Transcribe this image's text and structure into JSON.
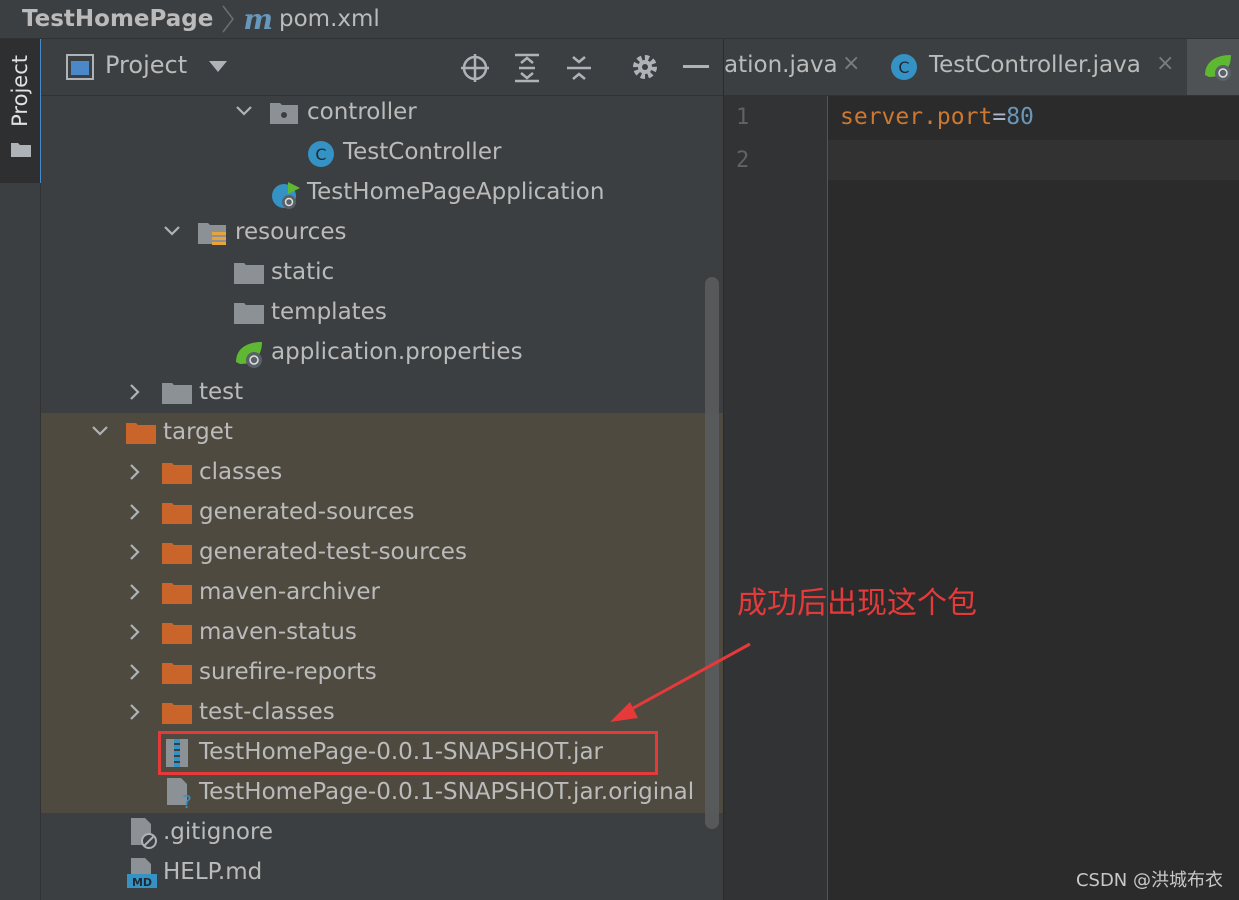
{
  "breadcrumb": {
    "project": "TestHomePage",
    "file_icon_letter": "m",
    "file": "pom.xml"
  },
  "left_strip": {
    "project_tab": "Project"
  },
  "project_panel": {
    "title": "Project",
    "tree": [
      {
        "label": "controller",
        "type": "package",
        "expanded": true
      },
      {
        "label": "TestController",
        "type": "class",
        "icon_letter": "C"
      },
      {
        "label": "TestHomePageApplication",
        "type": "spring-app"
      },
      {
        "label": "resources",
        "type": "resources-folder",
        "expanded": true
      },
      {
        "label": "static",
        "type": "folder"
      },
      {
        "label": "templates",
        "type": "folder"
      },
      {
        "label": "application.properties",
        "type": "spring-properties"
      },
      {
        "label": "test",
        "type": "folder",
        "expanded": false
      },
      {
        "label": "target",
        "type": "excluded-folder",
        "expanded": true
      },
      {
        "label": "classes",
        "type": "excluded-folder",
        "expanded": false
      },
      {
        "label": "generated-sources",
        "type": "excluded-folder",
        "expanded": false
      },
      {
        "label": "generated-test-sources",
        "type": "excluded-folder",
        "expanded": false
      },
      {
        "label": "maven-archiver",
        "type": "excluded-folder",
        "expanded": false
      },
      {
        "label": "maven-status",
        "type": "excluded-folder",
        "expanded": false
      },
      {
        "label": "surefire-reports",
        "type": "excluded-folder",
        "expanded": false
      },
      {
        "label": "test-classes",
        "type": "excluded-folder",
        "expanded": false
      },
      {
        "label": "TestHomePage-0.0.1-SNAPSHOT.jar",
        "type": "jar"
      },
      {
        "label": "TestHomePage-0.0.1-SNAPSHOT.jar.original",
        "type": "unknown-file"
      },
      {
        "label": ".gitignore",
        "type": "ignore-file"
      },
      {
        "label": "HELP.md",
        "type": "markdown",
        "icon_letter": "MD"
      }
    ]
  },
  "editor": {
    "tabs": [
      {
        "label": "ation.java",
        "close": "×"
      },
      {
        "label": "TestController.java",
        "icon_letter": "C",
        "close": "×"
      },
      {
        "label": "",
        "active": true
      }
    ],
    "line_numbers": [
      "1",
      "2"
    ],
    "code": {
      "key": "server.port",
      "eq": "=",
      "value": "80"
    }
  },
  "annotation": {
    "text": "成功后出现这个包",
    "color": "#e63a3a"
  },
  "watermark": "CSDN @洪城布衣",
  "colors": {
    "panel_bg": "#3c3f41",
    "editor_bg": "#2b2b2b",
    "excluded_folder": "#c9652b",
    "highlight_row": "#4e4a40",
    "accent_blue": "#4a88c7"
  }
}
